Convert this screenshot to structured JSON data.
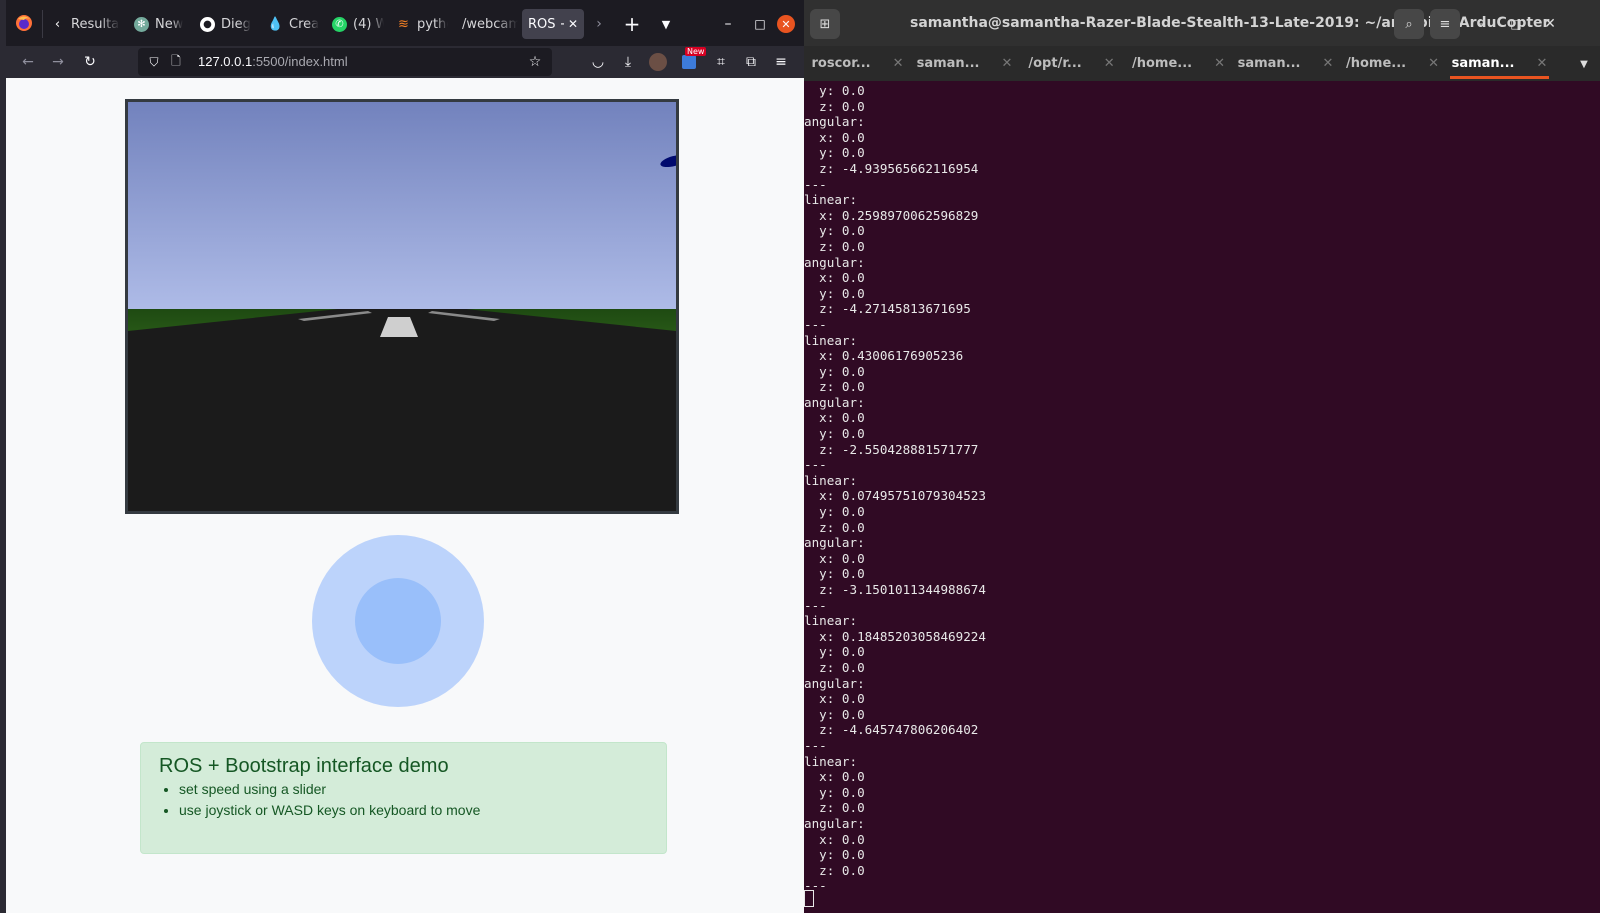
{
  "browser": {
    "tabs": [
      {
        "label": "Resultad",
        "icon": "back-arrow-icon"
      },
      {
        "label": "New",
        "icon": "chatgpt-icon"
      },
      {
        "label": "Dieg",
        "icon": "github-icon"
      },
      {
        "label": "Crea",
        "icon": "droplet-icon"
      },
      {
        "label": "(4) W",
        "icon": "whatsapp-icon"
      },
      {
        "label": "pytho",
        "icon": "stackoverflow-icon"
      },
      {
        "label": "/webcam",
        "icon": ""
      },
      {
        "label": "ROS + ",
        "icon": ""
      }
    ],
    "url_host": "127.0.0.1",
    "url_path": ":5500/index.html",
    "new_badge": "New"
  },
  "page": {
    "heading": "ROS + Bootstrap interface demo",
    "list": [
      "set speed using a slider",
      "use joystick or WASD keys on keyboard to move"
    ]
  },
  "terminal": {
    "title": "samantha@samantha-Razer-Blade-Stealth-13-Late-2019: ~/ardupilot/ArduCopter",
    "tabs": [
      "roscor...",
      "saman...",
      "/opt/r...",
      "/home...",
      "saman...",
      "/home...",
      "saman..."
    ],
    "active_tab": 6,
    "output": "  y: 0.0\n  z: 0.0\nangular:\n  x: 0.0\n  y: 0.0\n  z: -4.939565662116954\n---\nlinear:\n  x: 0.2598970062596829\n  y: 0.0\n  z: 0.0\nangular:\n  x: 0.0\n  y: 0.0\n  z: -4.27145813671695\n---\nlinear:\n  x: 0.43006176905236\n  y: 0.0\n  z: 0.0\nangular:\n  x: 0.0\n  y: 0.0\n  z: -2.550428881571777\n---\nlinear:\n  x: 0.07495751079304523\n  y: 0.0\n  z: 0.0\nangular:\n  x: 0.0\n  y: 0.0\n  z: -3.1501011344988674\n---\nlinear:\n  x: 0.18485203058469224\n  y: 0.0\n  z: 0.0\nangular:\n  x: 0.0\n  y: 0.0\n  z: -4.645747806206402\n---\nlinear:\n  x: 0.0\n  y: 0.0\n  z: 0.0\nangular:\n  x: 0.0\n  y: 0.0\n  z: 0.0\n---"
  },
  "colors": {
    "terminal_bg": "#300a24",
    "alert_bg": "#d4ecd9",
    "alert_text": "#155724",
    "joystick_outer": "#bcd3fb",
    "joystick_inner": "#99bffa",
    "terminal_accent": "#e95420"
  }
}
